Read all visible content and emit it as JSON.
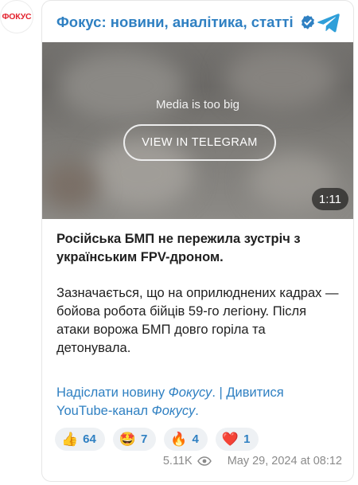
{
  "avatar": {
    "text": "ФОКУС"
  },
  "channel": {
    "title": "Фокус: новини, аналітика, статті",
    "verified": true
  },
  "media": {
    "message": "Media is too big",
    "button_label": "VIEW IN TELEGRAM",
    "duration": "1:11"
  },
  "post": {
    "headline": "Російська БМП не пережила зустріч з українським FPV-дроном.",
    "body": "Зазначається, що на оприлюднених кадрах — бойова робота бійців 59-го легіону. Після атаки ворожа БМП довго горіла та детонувала.",
    "link1_text": "Надіслати новину ",
    "link1_italic": "Фокусу",
    "link1_end": ".",
    "separator": " | ",
    "link2_text": "Дивитися YouTube-канал ",
    "link2_italic": "Фокусу",
    "link2_end": "."
  },
  "reactions": [
    {
      "emoji": "👍",
      "count": "64"
    },
    {
      "emoji": "🤩",
      "count": "7"
    },
    {
      "emoji": "🔥",
      "count": "4"
    },
    {
      "emoji": "❤️",
      "count": "1"
    }
  ],
  "meta": {
    "views": "5.11K",
    "date": "May 29, 2024 at 08:12"
  },
  "colors": {
    "accent": "#2f80c2",
    "brand_red": "#e3232e"
  },
  "icons": {
    "verified": "verified-badge-icon",
    "telegram": "telegram-icon",
    "views": "eye-icon"
  }
}
